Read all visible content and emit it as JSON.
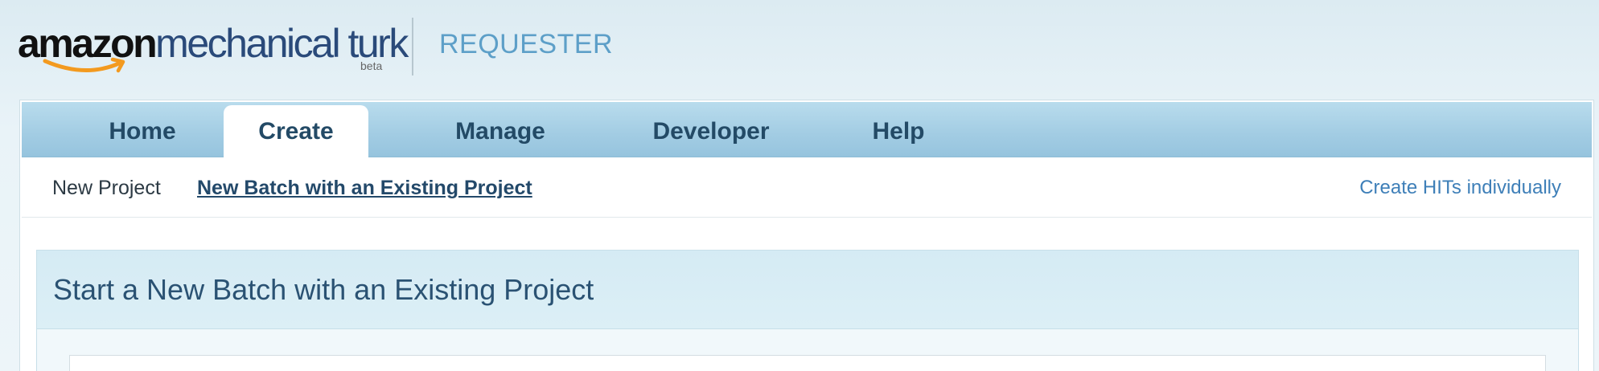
{
  "header": {
    "logo": {
      "amazon": "amazon",
      "mturk": "mechanical turk",
      "beta": "beta",
      "icon": "amazon-smile-icon"
    },
    "portal_label": "REQUESTER"
  },
  "tabs": [
    {
      "label": "Home",
      "active": false
    },
    {
      "label": "Create",
      "active": true
    },
    {
      "label": "Manage",
      "active": false
    },
    {
      "label": "Developer",
      "active": false
    },
    {
      "label": "Help",
      "active": false
    }
  ],
  "subnav": {
    "new_project": "New Project",
    "new_batch": "New Batch with an Existing Project",
    "create_hits": "Create HITs individually"
  },
  "section": {
    "title": "Start a New Batch with an Existing Project"
  },
  "colors": {
    "tab_text": "#234a66",
    "requester": "#5d9fc8",
    "link": "#3e7fb8",
    "smile": "#f39a1f"
  }
}
